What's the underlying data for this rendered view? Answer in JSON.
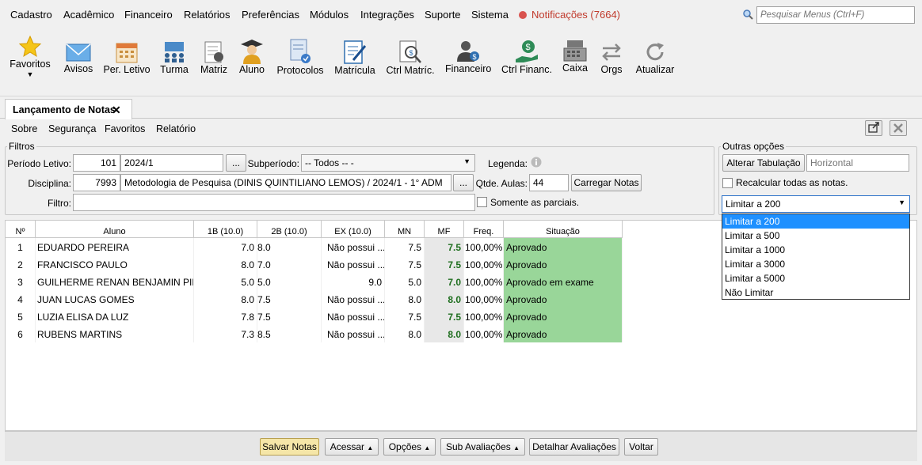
{
  "menu": {
    "items": [
      "Cadastro",
      "Acadêmico",
      "Financeiro",
      "Relatórios",
      "Preferências",
      "Módulos",
      "Integrações",
      "Suporte",
      "Sistema"
    ],
    "notifications": "Notificações (7664)",
    "search_placeholder": "Pesquisar Menus (Ctrl+F)"
  },
  "toolbar": {
    "items": [
      "Favoritos",
      "Avisos",
      "Per. Letivo",
      "Turma",
      "Matriz",
      "Aluno",
      "Protocolos",
      "Matrícula",
      "Ctrl Matríc.",
      "Financeiro",
      "Ctrl Financ.",
      "Caixa",
      "Orgs",
      "Atualizar"
    ]
  },
  "tab": {
    "label": "Lançamento de Notas",
    "close": "✕"
  },
  "submenu": [
    "Sobre",
    "Segurança",
    "Favoritos",
    "Relatório"
  ],
  "filtros": {
    "legend": "Filtros",
    "periodo_label": "Período Letivo:",
    "periodo_code": "101",
    "periodo_value": "2024/1",
    "subperiodo_label": "Subperíodo:",
    "subperiodo_value": "-- Todos -- -",
    "legenda_label": "Legenda:",
    "disciplina_label": "Disciplina:",
    "disciplina_code": "7993",
    "disciplina_value": "Metodologia de Pesquisa (DINIS QUINTILIANO LEMOS) / 2024/1 - 1° ADM",
    "qtde_label": "Qtde. Aulas:",
    "qtde_value": "44",
    "carregar_label": "Carregar Notas",
    "filtro_label": "Filtro:",
    "filtro_value": "",
    "parciais_label": "Somente as parciais.",
    "ellipsis": "..."
  },
  "outras": {
    "legend": "Outras opções",
    "alterar_label": "Alterar Tabulação",
    "horizontal_placeholder": "Horizontal",
    "recalcular_label": "Recalcular todas as notas.",
    "limit_value": "Limitar a 200",
    "options": [
      "Limitar a 200",
      "Limitar a 500",
      "Limitar a 1000",
      "Limitar a 3000",
      "Limitar a 5000",
      "Não Limitar"
    ]
  },
  "grid": {
    "headers": [
      "Nº",
      "Aluno",
      "1B (10.0)",
      "2B (10.0)",
      "EX (10.0)",
      "MN",
      "MF",
      "Freq.",
      "Situação"
    ],
    "rows": [
      {
        "n": "1",
        "aluno": "EDUARDO PEREIRA",
        "b1": "7.0",
        "b2": "8.0",
        "ex": "Não possui ...",
        "mn": "7.5",
        "mf": "7.5",
        "freq": "100,00%",
        "sit": "Aprovado"
      },
      {
        "n": "2",
        "aluno": "FRANCISCO PAULO",
        "b1": "8.0",
        "b2": "7.0",
        "ex": "Não possui ...",
        "mn": "7.5",
        "mf": "7.5",
        "freq": "100,00%",
        "sit": "Aprovado"
      },
      {
        "n": "3",
        "aluno": "GUILHERME RENAN BENJAMIN PIR...",
        "b1": "5.0",
        "b2": "5.0",
        "ex": "9.0",
        "mn": "5.0",
        "mf": "7.0",
        "freq": "100,00%",
        "sit": "Aprovado em exame"
      },
      {
        "n": "4",
        "aluno": "JUAN LUCAS GOMES",
        "b1": "8.0",
        "b2": "7.5",
        "ex": "Não possui ...",
        "mn": "8.0",
        "mf": "8.0",
        "freq": "100,00%",
        "sit": "Aprovado"
      },
      {
        "n": "5",
        "aluno": "LUZIA ELISA DA LUZ",
        "b1": "7.8",
        "b2": "7.5",
        "ex": "Não possui ...",
        "mn": "7.5",
        "mf": "7.5",
        "freq": "100,00%",
        "sit": "Aprovado"
      },
      {
        "n": "6",
        "aluno": "RUBENS MARTINS",
        "b1": "7.3",
        "b2": "8.5",
        "ex": "Não possui ...",
        "mn": "8.0",
        "mf": "8.0",
        "freq": "100,00%",
        "sit": "Aprovado"
      }
    ]
  },
  "bottom": {
    "salvar": "Salvar Notas",
    "acessar": "Acessar",
    "opcoes": "Opções",
    "sub_aval": "Sub Avaliações",
    "detalhar": "Detalhar Avaliações",
    "voltar": "Voltar"
  },
  "colors": {
    "accent": "#f5e6a8",
    "approved": "#99d699",
    "selected": "#1e90ff",
    "mf_text": "#1e6e1e"
  }
}
